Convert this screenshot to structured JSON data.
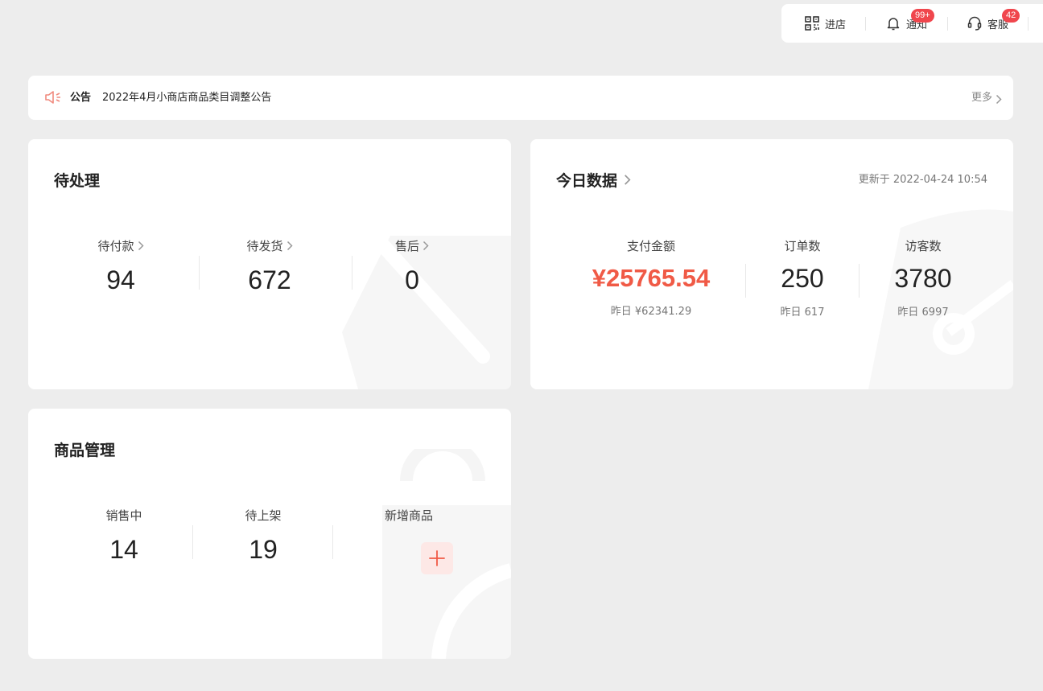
{
  "topbar": {
    "items": [
      {
        "label": "进店",
        "icon": "qrcode-icon"
      },
      {
        "label": "通知",
        "icon": "bell-icon",
        "badge": "99+"
      },
      {
        "label": "客服",
        "icon": "headset-icon",
        "badge": "42"
      }
    ]
  },
  "notice": {
    "tag": "公告",
    "text": "2022年4月小商店商品类目调整公告",
    "more": "更多"
  },
  "pending": {
    "title": "待处理",
    "items": [
      {
        "label": "待付款",
        "value": "94"
      },
      {
        "label": "待发货",
        "value": "672"
      },
      {
        "label": "售后",
        "value": "0"
      }
    ]
  },
  "today": {
    "title": "今日数据",
    "updated": "更新于 2022-04-24 10:54",
    "items": [
      {
        "label": "支付金额",
        "value": "¥25765.54",
        "sub": "昨日 ¥62341.29"
      },
      {
        "label": "订单数",
        "value": "250",
        "sub": "昨日 617"
      },
      {
        "label": "访客数",
        "value": "3780",
        "sub": "昨日 6997"
      }
    ]
  },
  "goods": {
    "title": "商品管理",
    "items": [
      {
        "label": "销售中",
        "value": "14"
      },
      {
        "label": "待上架",
        "value": "19"
      },
      {
        "label": "新增商品"
      }
    ]
  },
  "colors": {
    "accent": "#f05a46",
    "badge": "#f0464d",
    "background": "#ededed"
  }
}
